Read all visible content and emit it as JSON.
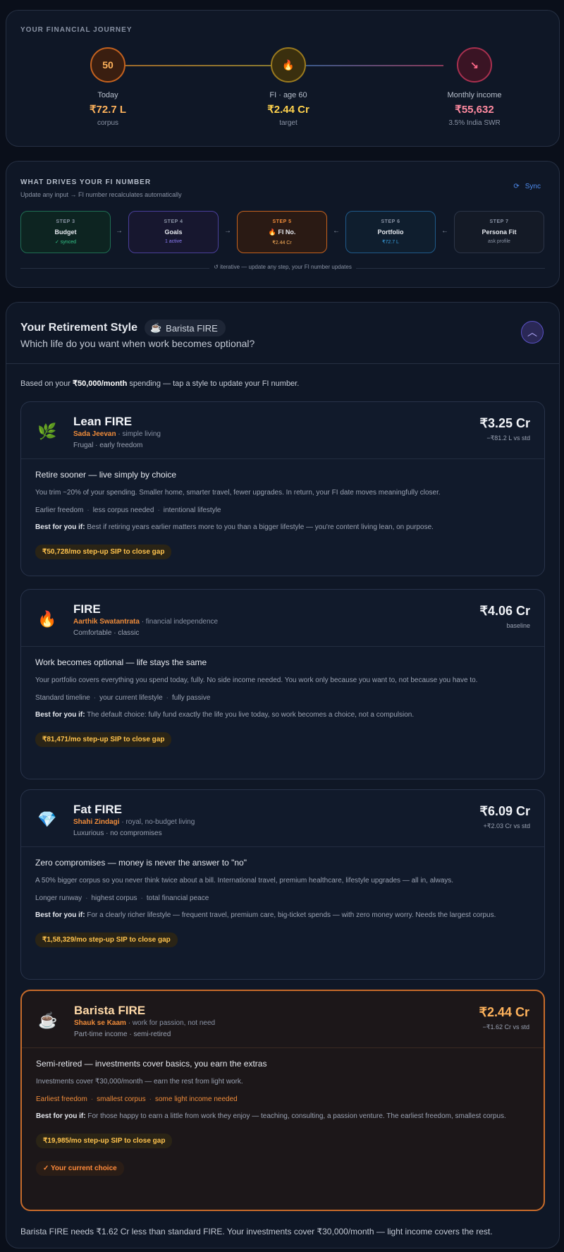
{
  "journey": {
    "title": "YOUR FINANCIAL JOURNEY",
    "nodes": [
      {
        "circle": "50",
        "label": "Today",
        "value": "₹72.7 L",
        "sub": "corpus",
        "color": "#f08c3a"
      },
      {
        "circle": "🔥",
        "label": "FI · age 60",
        "value": "₹2.44 Cr",
        "sub": "target",
        "color": "#e0b43a"
      },
      {
        "circle": "↘",
        "label": "Monthly income",
        "value": "₹55,632",
        "sub": "3.5% India SWR",
        "color": "#f0557a"
      }
    ]
  },
  "drivers": {
    "title": "WHAT DRIVES YOUR FI NUMBER",
    "subtitle": "Update any input → FI number recalculates automatically",
    "sync_label": "Sync",
    "steps": [
      {
        "num": "STEP 3",
        "name": "Budget",
        "status": "✓ synced",
        "color": "#34c68a"
      },
      {
        "num": "STEP 4",
        "name": "Goals",
        "status": "1 active",
        "color": "#8b7cf6"
      },
      {
        "num": "STEP 5",
        "name": "🔥 FI No.",
        "status": "₹2.44 Cr",
        "color": "#f08c3a"
      },
      {
        "num": "STEP 6",
        "name": "Portfolio",
        "status": "₹72.7 L",
        "color": "#3aa0e0"
      },
      {
        "num": "STEP 7",
        "name": "Persona Fit",
        "status": "ask profile",
        "color": "#8a93a5"
      }
    ],
    "arrows": [
      "→",
      "→",
      "←",
      "←"
    ],
    "footer": "↺ iterative — update any step, your FI number updates"
  },
  "retire": {
    "title": "Your Retirement Style",
    "badge_icon": "☕",
    "badge": "Barista FIRE",
    "question": "Which life do you want when work becomes optional?",
    "intro_pre": "Based on your ",
    "intro_amount": "₹50,000/month",
    "intro_post": " spending — tap a style to update your FI number.",
    "footer": "Barista FIRE needs ₹1.62 Cr less than standard FIRE. Your investments cover ₹30,000/month — light income covers the rest.",
    "styles": [
      {
        "icon": "🌿",
        "name": "Lean FIRE",
        "hindi": "Sada Jeevan",
        "tagline": " · simple living",
        "meta": "Frugal · early freedom",
        "amount": "₹3.25 Cr",
        "delta": "−₹81.2 L vs std",
        "headline": "Retire sooner — live simply by choice",
        "desc": "You trim ~20% of your spending. Smaller home, smarter travel, fewer upgrades. In return, your FI date moves meaningfully closer.",
        "tags": [
          "Earlier freedom",
          "less corpus needed",
          "intentional lifestyle"
        ],
        "best_label": "Best for you if:",
        "best": " Best if retiring years earlier matters more to you than a bigger lifestyle — you're content living lean, on purpose.",
        "sip": "₹50,728/mo step-up SIP to close gap"
      },
      {
        "icon": "🔥",
        "name": "FIRE",
        "hindi": "Aarthik Swatantrata",
        "tagline": " · financial independence",
        "meta": "Comfortable · classic",
        "amount": "₹4.06 Cr",
        "delta": "baseline",
        "headline": "Work becomes optional — life stays the same",
        "desc": "Your portfolio covers everything you spend today, fully. No side income needed. You work only because you want to, not because you have to.",
        "tags": [
          "Standard timeline",
          "your current lifestyle",
          "fully passive"
        ],
        "best_label": "Best for you if:",
        "best": " The default choice: fully fund exactly the life you live today, so work becomes a choice, not a compulsion.",
        "sip": "₹81,471/mo step-up SIP to close gap"
      },
      {
        "icon": "💎",
        "name": "Fat FIRE",
        "hindi": "Shahi Zindagi",
        "tagline": " · royal, no-budget living",
        "meta": "Luxurious · no compromises",
        "amount": "₹6.09 Cr",
        "delta": "+₹2.03 Cr vs std",
        "headline": "Zero compromises — money is never the answer to \"no\"",
        "desc": "A 50% bigger corpus so you never think twice about a bill. International travel, premium healthcare, lifestyle upgrades — all in, always.",
        "tags": [
          "Longer runway",
          "highest corpus",
          "total financial peace"
        ],
        "best_label": "Best for you if:",
        "best": " For a clearly richer lifestyle — frequent travel, premium care, big-ticket spends — with zero money worry. Needs the largest corpus.",
        "sip": "₹1,58,329/mo step-up SIP to close gap"
      },
      {
        "icon": "☕",
        "name": "Barista FIRE",
        "hindi": "Shauk se Kaam",
        "tagline": " · work for passion, not need",
        "meta": "Part-time income · semi-retired",
        "amount": "₹2.44 Cr",
        "delta": "−₹1.62 Cr vs std",
        "headline": "Semi-retired — investments cover basics, you earn the extras",
        "desc": "Investments cover ₹30,000/month — earn the rest from light work.",
        "tags": [
          "Earliest freedom",
          "smallest corpus",
          "some light income needed"
        ],
        "best_label": "Best for you if:",
        "best": " For those happy to earn a little from work they enjoy — teaching, consulting, a passion venture. The earliest freedom, smallest corpus.",
        "sip": "₹19,985/mo step-up SIP to close gap",
        "current_label": "✓ Your current choice"
      }
    ]
  }
}
